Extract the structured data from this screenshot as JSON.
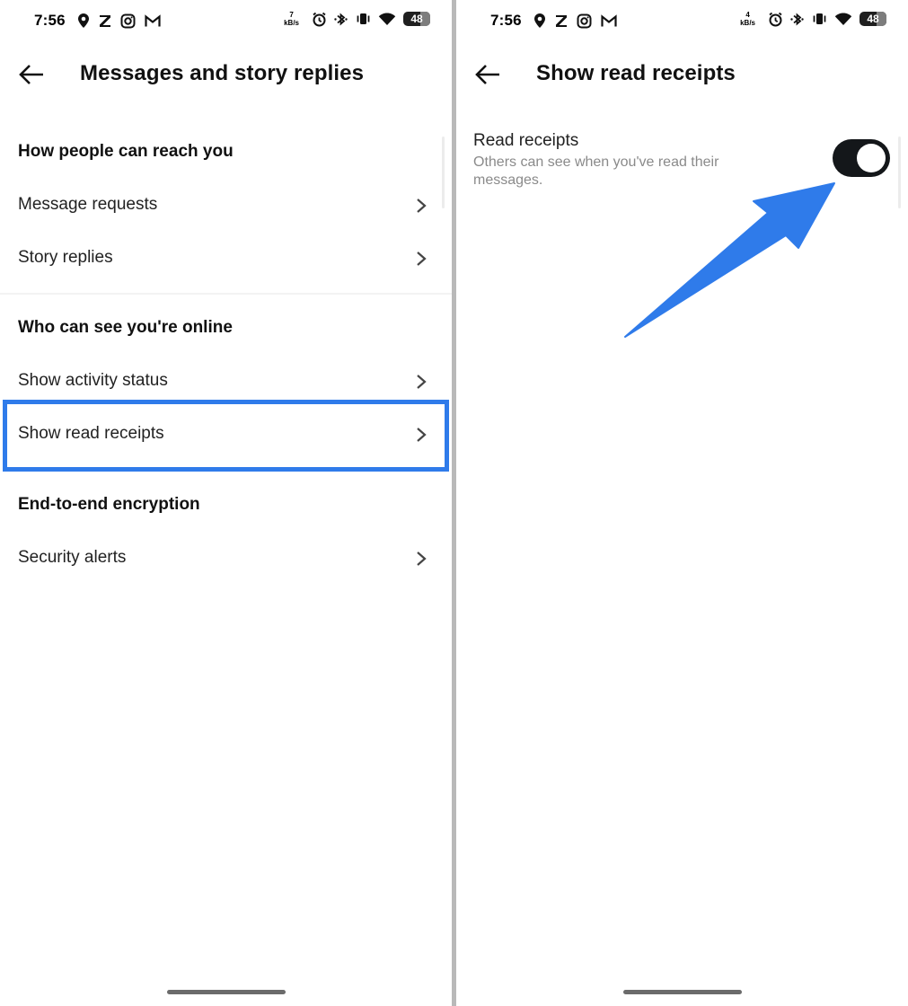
{
  "left_screen": {
    "status_bar": {
      "time": "7:56",
      "net_speed_value": "7",
      "net_speed_unit": "kB/s",
      "battery": "48"
    },
    "header": {
      "title": "Messages and story replies"
    },
    "sections": [
      {
        "title": "How people can reach you",
        "items": [
          {
            "label": "Message requests"
          },
          {
            "label": "Story replies"
          }
        ]
      },
      {
        "title": "Who can see you're online",
        "items": [
          {
            "label": "Show activity status"
          },
          {
            "label": "Show read receipts"
          }
        ]
      },
      {
        "title": "End-to-end encryption",
        "items": [
          {
            "label": "Security alerts"
          }
        ]
      }
    ],
    "highlighted_item": "Show read receipts",
    "highlight_color": "#2f7bea"
  },
  "right_screen": {
    "status_bar": {
      "time": "7:56",
      "net_speed_value": "4",
      "net_speed_unit": "kB/s",
      "battery": "48"
    },
    "header": {
      "title": "Show read receipts"
    },
    "setting": {
      "title": "Read receipts",
      "description": "Others can see when you've read their messages.",
      "enabled": true
    },
    "annotation_arrow_color": "#2f7bea"
  },
  "icons": {
    "status_left": [
      "location-pin-icon",
      "z-app-icon",
      "instagram-icon",
      "gmail-icon"
    ],
    "status_right": [
      "alarm-icon",
      "bluetooth-icon",
      "vibrate-icon",
      "wifi-icon",
      "battery-icon"
    ],
    "nav": [
      "back-arrow-icon",
      "chevron-right-icon"
    ]
  }
}
